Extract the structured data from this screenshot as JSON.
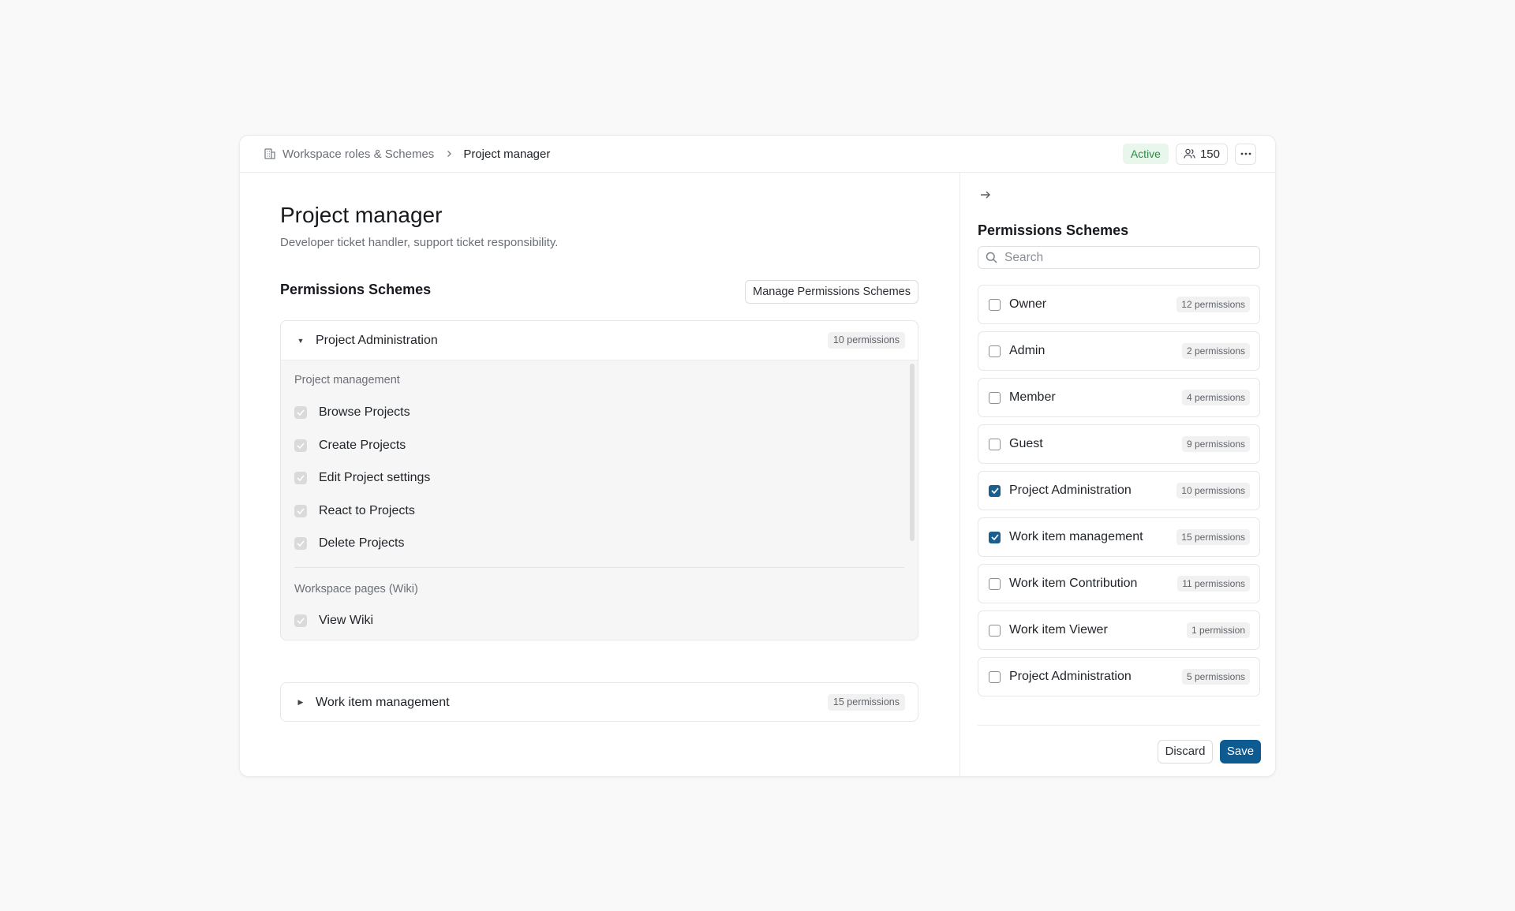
{
  "breadcrumb": {
    "icon": "building-icon",
    "parent": "Workspace roles & Schemes",
    "current": "Project manager"
  },
  "header": {
    "status": "Active",
    "member_count": "150",
    "members_icon": "users-icon",
    "more_icon": "more-horizontal-icon"
  },
  "role": {
    "title": "Project manager",
    "description": "Developer ticket handler, support ticket responsibility."
  },
  "main": {
    "section_title": "Permissions Schemes",
    "manage_label": "Manage Permissions Schemes",
    "accordions": [
      {
        "title": "Project Administration",
        "count": "10 permissions",
        "expanded": true,
        "groups": [
          {
            "label": "Project management",
            "permissions": [
              "Browse Projects",
              "Create Projects",
              "Edit Project settings",
              "React to Projects",
              "Delete Projects"
            ]
          },
          {
            "label": "Workspace pages (Wiki)",
            "permissions": [
              "View Wiki"
            ]
          }
        ]
      },
      {
        "title": "Work item management",
        "count": "15 permissions",
        "expanded": false
      }
    ]
  },
  "side": {
    "arrow_icon": "arrow-right-icon",
    "title": "Permissions Schemes",
    "search": {
      "placeholder": "Search",
      "value": ""
    },
    "schemes": [
      {
        "name": "Owner",
        "count": "12 permissions",
        "checked": false
      },
      {
        "name": "Admin",
        "count": "2 permissions",
        "checked": false
      },
      {
        "name": "Member",
        "count": "4 permissions",
        "checked": false
      },
      {
        "name": "Guest",
        "count": "9 permissions",
        "checked": false
      },
      {
        "name": "Project Administration",
        "count": "10 permissions",
        "checked": true
      },
      {
        "name": "Work item management",
        "count": "15 permissions",
        "checked": true
      },
      {
        "name": "Work item Contribution",
        "count": "11 permissions",
        "checked": false
      },
      {
        "name": "Work item Viewer",
        "count": "1 permission",
        "checked": false
      },
      {
        "name": "Project Administration",
        "count": "5 permissions",
        "checked": false
      }
    ],
    "discard_label": "Discard",
    "save_label": "Save"
  },
  "colors": {
    "accent": "#0d5b91",
    "checkbox_checked": "#1a5d8f",
    "active_badge_bg": "#e8f6ec",
    "active_badge_text": "#2f8a46"
  }
}
